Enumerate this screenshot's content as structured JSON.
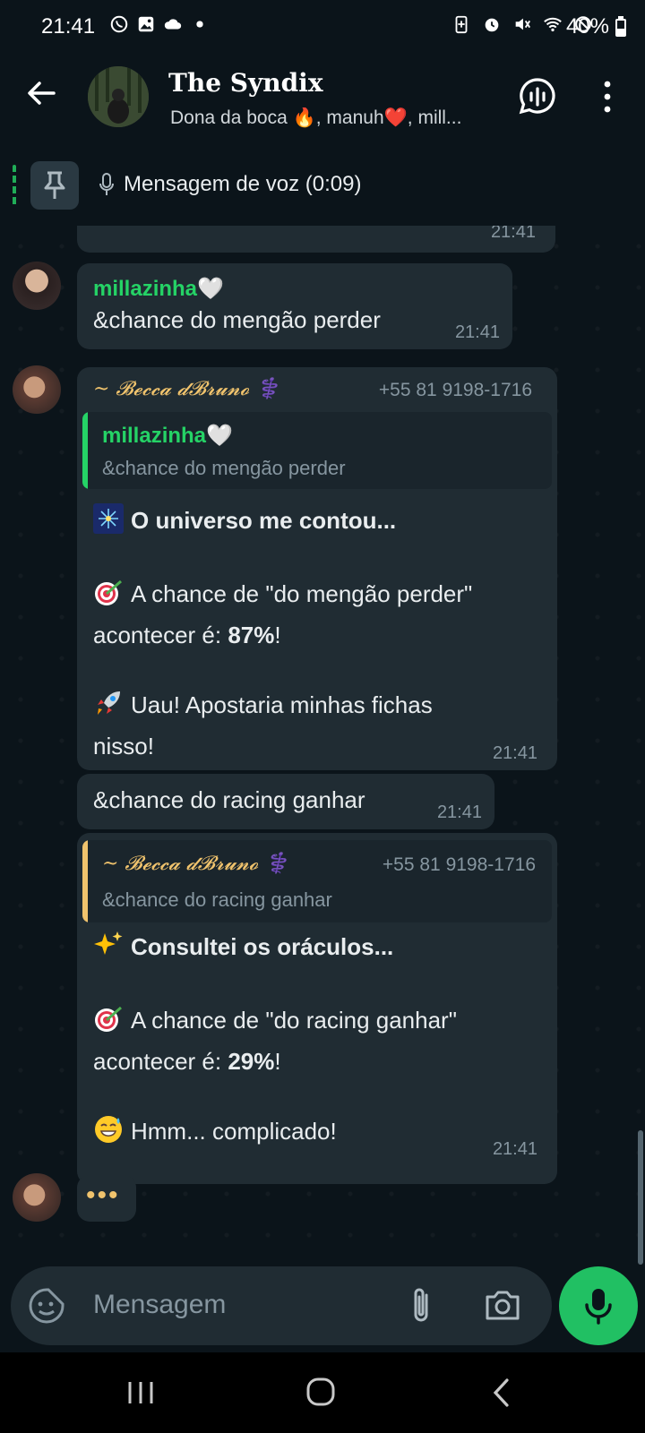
{
  "status_bar": {
    "time": "21:41",
    "battery": "40%"
  },
  "header": {
    "title": "The Syndix",
    "subtitle": "Dona da boca 🔥, manuh❤️, mill..."
  },
  "pinned": {
    "text": "Mensagem de voz (0:09)"
  },
  "messages": {
    "m0": {
      "time": "21:41"
    },
    "m1": {
      "sender": "millazinha🤍",
      "text": "&chance do mengão perder",
      "time": "21:41"
    },
    "m2": {
      "sender": "~ 𝓑𝓮𝓬𝓬𝓪 𝓭𝓑𝓻𝓾𝓷𝓸 ⚕️",
      "phone": "+55 81 9198-1716",
      "quote_sender": "millazinha🤍",
      "quote_text": "&chance do mengão perder",
      "line1": "O universo me contou...",
      "line2a": "A chance de \"do mengão perder\"",
      "line2b": "acontecer é: ",
      "line2_value": "87%",
      "line2_end": "!",
      "line3a": "Uau! Apostaria minhas fichas",
      "line3b": "nisso!",
      "time": "21:41"
    },
    "m3": {
      "text": "&chance do racing ganhar",
      "time": "21:41"
    },
    "m4": {
      "quote_sender": "~ 𝓑𝓮𝓬𝓬𝓪 𝓭𝓑𝓻𝓾𝓷𝓸 ⚕️",
      "quote_phone": "+55 81 9198-1716",
      "quote_text": "&chance do racing ganhar",
      "line1": "Consultei os oráculos...",
      "line2a": "A chance de \"do racing ganhar\"",
      "line2b": "acontecer é: ",
      "line2_value": "29%",
      "line2_end": "!",
      "line3": "Hmm... complicado!",
      "time": "21:41"
    },
    "typing": "•••"
  },
  "input": {
    "placeholder": "Mensagem"
  },
  "colors": {
    "accent_green": "#21c063",
    "bubble": "#202c33",
    "background": "#0b141a",
    "sender_green": "#25d366",
    "quote_yellow": "#f0c36d"
  }
}
